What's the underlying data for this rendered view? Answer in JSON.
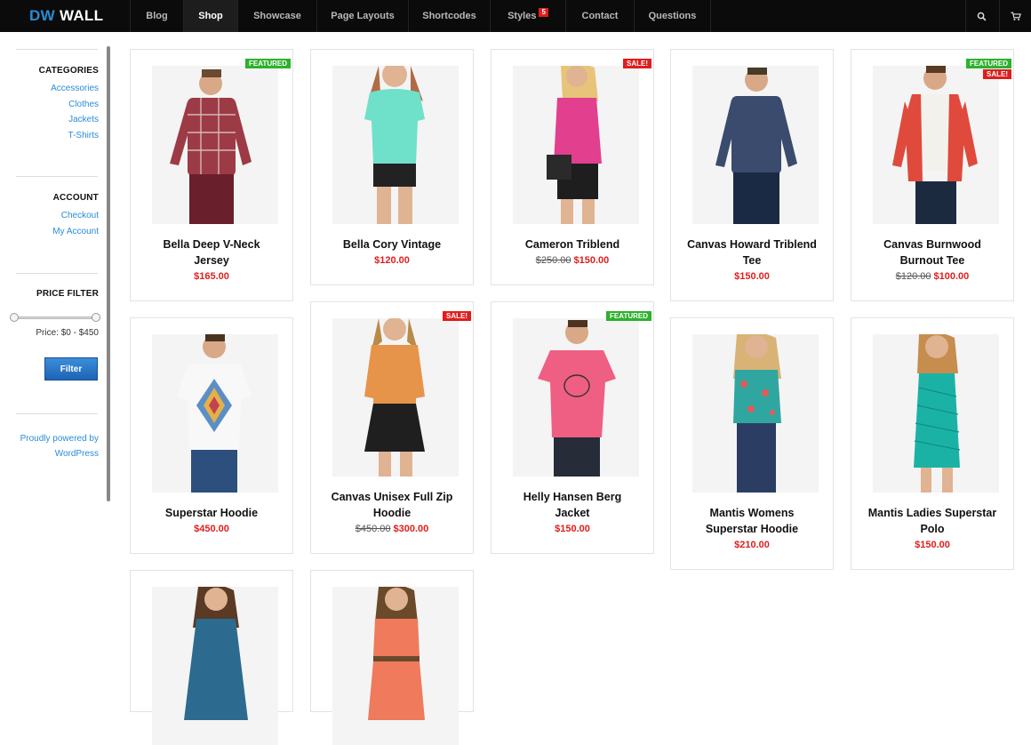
{
  "brand": {
    "accent": "DW",
    "name": "WALL"
  },
  "nav": [
    {
      "label": "Blog"
    },
    {
      "label": "Shop",
      "active": true
    },
    {
      "label": "Showcase"
    },
    {
      "label": "Page Layouts"
    },
    {
      "label": "Shortcodes"
    },
    {
      "label": "Styles",
      "badge": "5"
    },
    {
      "label": "Contact"
    },
    {
      "label": "Questions"
    }
  ],
  "sidebar": {
    "categories_title": "CATEGORIES",
    "categories": [
      "Accessories",
      "Clothes",
      "Jackets",
      "T-Shirts"
    ],
    "account_title": "ACCOUNT",
    "account": [
      "Checkout",
      "My Account"
    ],
    "price_title": "PRICE FILTER",
    "price_range": "Price: $0 - $450",
    "filter_label": "Filter",
    "powered_line1": "Proudly powered by",
    "powered_line2": "WordPress"
  },
  "products": [
    {
      "name_l1": "Bella Deep V-Neck",
      "name_l2": "Jersey",
      "price": "$165.00",
      "old_price": "",
      "tags": [
        "FEATURED"
      ]
    },
    {
      "name_l1": "Bella Cory Vintage",
      "name_l2": "",
      "price": "$120.00",
      "old_price": "",
      "tags": []
    },
    {
      "name_l1": "Cameron Triblend",
      "name_l2": "",
      "price": "$150.00",
      "old_price": "$250.00",
      "tags": [
        "SALE!"
      ]
    },
    {
      "name_l1": "Canvas Howard Triblend",
      "name_l2": "Tee",
      "price": "$150.00",
      "old_price": "",
      "tags": []
    },
    {
      "name_l1": "Canvas Burnwood",
      "name_l2": "Burnout Tee",
      "price": "$100.00",
      "old_price": "$120.00",
      "tags": [
        "FEATURED",
        "SALE!"
      ]
    },
    {
      "name_l1": "Superstar Hoodie",
      "name_l2": "",
      "price": "$450.00",
      "old_price": "",
      "tags": []
    },
    {
      "name_l1": "Canvas Unisex Full Zip",
      "name_l2": "Hoodie",
      "price": "$300.00",
      "old_price": "$450.00",
      "tags": [
        "SALE!"
      ]
    },
    {
      "name_l1": "Helly Hansen Berg",
      "name_l2": "Jacket",
      "price": "$150.00",
      "old_price": "",
      "tags": [
        "FEATURED"
      ]
    },
    {
      "name_l1": "Mantis Womens",
      "name_l2": "Superstar Hoodie",
      "price": "$210.00",
      "old_price": "",
      "tags": []
    },
    {
      "name_l1": "Mantis Ladies Superstar",
      "name_l2": "Polo",
      "price": "$150.00",
      "old_price": "",
      "tags": []
    },
    {
      "name_l1": "",
      "name_l2": "",
      "price": "",
      "old_price": "",
      "tags": []
    },
    {
      "name_l1": "",
      "name_l2": "",
      "price": "",
      "old_price": "",
      "tags": []
    }
  ],
  "colors": {
    "accent": "#2a8cd6",
    "sale": "#e01d1d",
    "featured": "#2db12d",
    "navbar": "#0b0b0b"
  },
  "icons": {
    "search": "search-icon",
    "cart": "cart-icon"
  }
}
